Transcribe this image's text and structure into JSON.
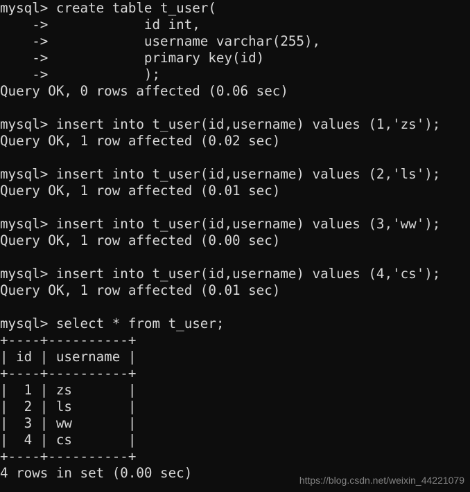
{
  "terminal": {
    "prompt": "mysql>",
    "continuation_prompt": "->",
    "background_color": "#0d0d0d",
    "text_color": "#d8d8d8",
    "lines": [
      "mysql> create table t_user(",
      "    ->            id int,",
      "    ->            username varchar(255),",
      "    ->            primary key(id)",
      "    ->            );",
      "Query OK, 0 rows affected (0.06 sec)",
      "",
      "mysql> insert into t_user(id,username) values (1,'zs');",
      "Query OK, 1 row affected (0.02 sec)",
      "",
      "mysql> insert into t_user(id,username) values (2,'ls');",
      "Query OK, 1 row affected (0.01 sec)",
      "",
      "mysql> insert into t_user(id,username) values (3,'ww');",
      "Query OK, 1 row affected (0.00 sec)",
      "",
      "mysql> insert into t_user(id,username) values (4,'cs');",
      "Query OK, 1 row affected (0.01 sec)",
      "",
      "mysql> select * from t_user;",
      "+----+----------+",
      "| id | username |",
      "+----+----------+",
      "|  1 | zs       |",
      "|  2 | ls       |",
      "|  3 | ww       |",
      "|  4 | cs       |",
      "+----+----------+",
      "4 rows in set (0.00 sec)"
    ],
    "commands": [
      {
        "sql": "create table t_user( id int, username varchar(255), primary key(id) );",
        "result": "Query OK, 0 rows affected (0.06 sec)",
        "rows_affected": 0,
        "duration_sec": "0.06"
      },
      {
        "sql": "insert into t_user(id,username) values (1,'zs');",
        "result": "Query OK, 1 row affected (0.02 sec)",
        "rows_affected": 1,
        "duration_sec": "0.02"
      },
      {
        "sql": "insert into t_user(id,username) values (2,'ls');",
        "result": "Query OK, 1 row affected (0.01 sec)",
        "rows_affected": 1,
        "duration_sec": "0.01"
      },
      {
        "sql": "insert into t_user(id,username) values (3,'ww');",
        "result": "Query OK, 1 row affected (0.00 sec)",
        "rows_affected": 1,
        "duration_sec": "0.00"
      },
      {
        "sql": "insert into t_user(id,username) values (4,'cs');",
        "result": "Query OK, 1 row affected (0.01 sec)",
        "rows_affected": 1,
        "duration_sec": "0.01"
      },
      {
        "sql": "select * from t_user;",
        "result": "4 rows in set (0.00 sec)",
        "row_count": 4,
        "duration_sec": "0.00"
      }
    ],
    "result_table": {
      "columns": [
        "id",
        "username"
      ],
      "rows": [
        [
          "1",
          "zs"
        ],
        [
          "2",
          "ls"
        ],
        [
          "3",
          "ww"
        ],
        [
          "4",
          "cs"
        ]
      ],
      "separator": "+----+----------+",
      "footer": "4 rows in set (0.00 sec)"
    }
  },
  "watermark": {
    "text": "https://blog.csdn.net/weixin_44221079",
    "color": "#8e8e8e"
  }
}
